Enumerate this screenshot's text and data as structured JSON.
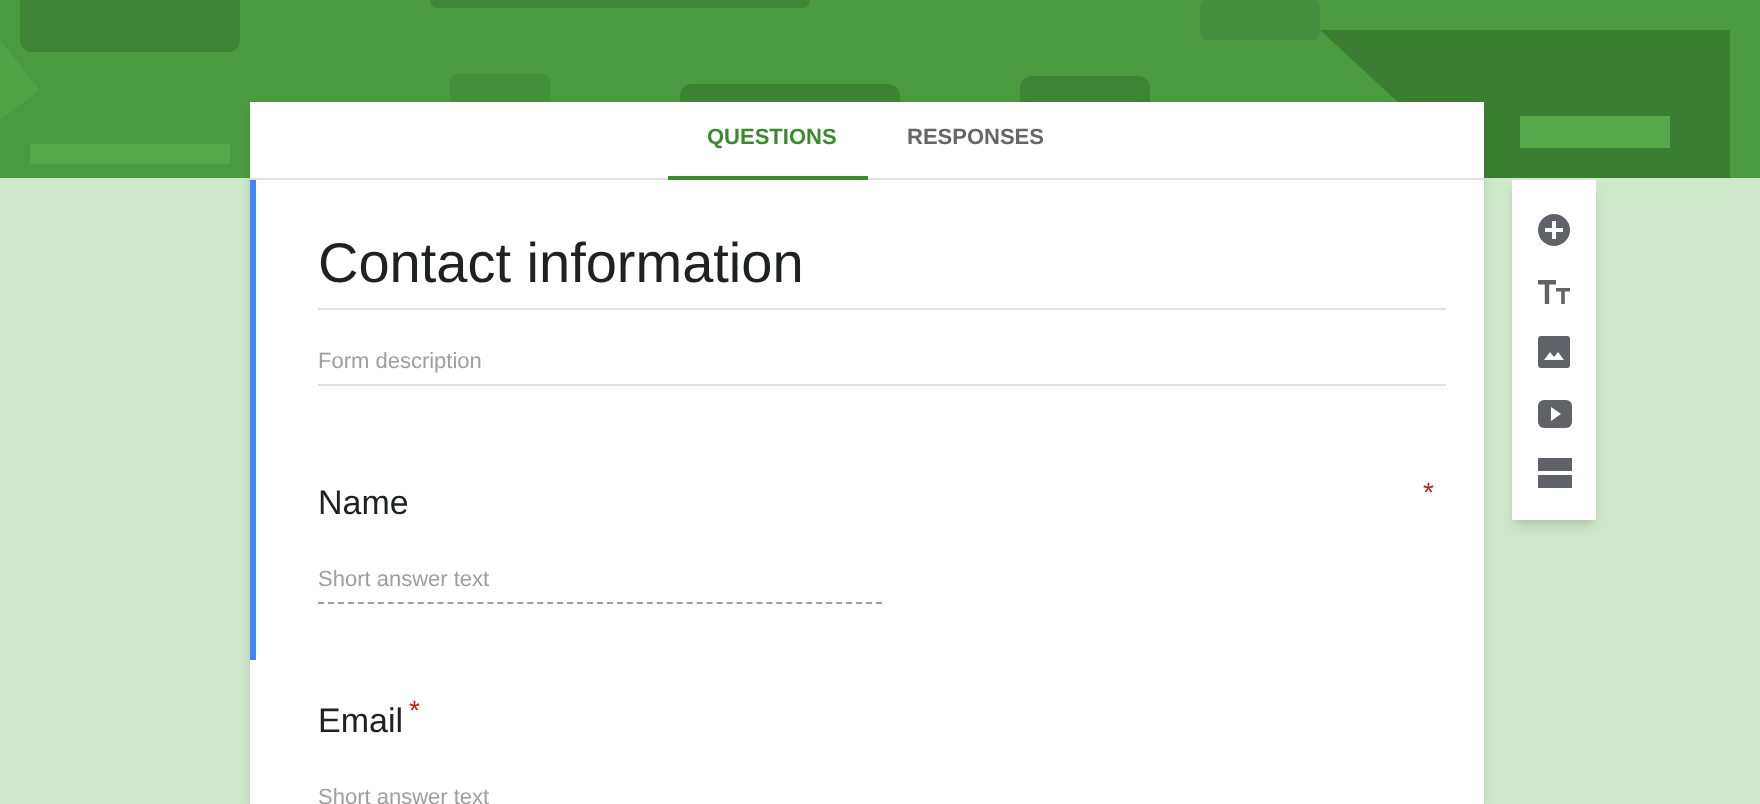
{
  "tabs": [
    {
      "label": "QUESTIONS",
      "selected": true
    },
    {
      "label": "RESPONSES",
      "selected": false
    }
  ],
  "form_header": {
    "title": "Contact information",
    "description_placeholder": "Form description",
    "selected": true
  },
  "questions": [
    {
      "title": "Name",
      "placeholder": "Short answer text",
      "required": true,
      "required_mark": "*",
      "selected": true
    },
    {
      "title": "Email",
      "placeholder": "Short answer text",
      "required": true,
      "required_mark": "*",
      "selected": false
    }
  ]
}
